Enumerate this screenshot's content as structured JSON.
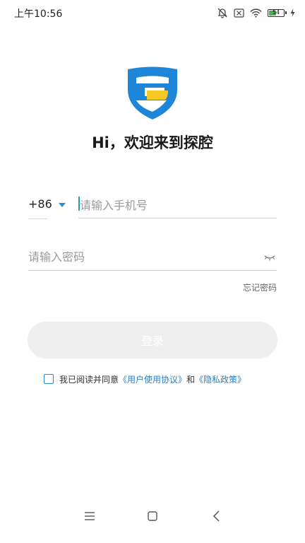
{
  "status_bar": {
    "time": "上午10:56",
    "battery_level": "54",
    "battery_fraction": 0.54,
    "icons": [
      "mute-bell-icon",
      "notification-blocked-icon",
      "wifi-icon",
      "battery-icon",
      "charging-bolt-icon"
    ]
  },
  "brand": {
    "logo_icon": "shield-logo-icon",
    "logo_colors": {
      "shield": "#1e86d8",
      "bar": "#f6c825"
    },
    "welcome": "Hi，欢迎来到探腔"
  },
  "login_form": {
    "country_code": "+86",
    "country_dropdown_icon": "caret-down-icon",
    "phone_placeholder": "请输入手机号",
    "phone_value": "",
    "password_placeholder": "请输入密码",
    "password_value": "",
    "password_toggle_icon": "eye-closed-icon",
    "forgot_password": "忘记密码",
    "login_label": "登录"
  },
  "agreement": {
    "checked": false,
    "prefix": "我已阅读并同意",
    "user_agreement": "《用户使用协议》",
    "conjunction": "和",
    "privacy_policy": "《隐私政策》"
  },
  "colors": {
    "accent_blue": "#2a7fc3",
    "input_caret": "#1fa3a1",
    "button_disabled_bg": "#efefef"
  },
  "nav_bar": {
    "icons": [
      "menu-icon",
      "home-icon",
      "back-icon"
    ]
  }
}
